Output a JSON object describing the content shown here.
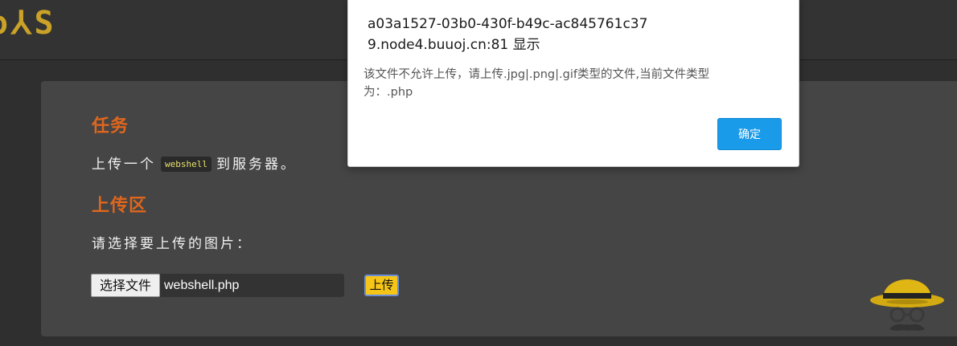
{
  "header": {
    "logo_text": "o⅄S"
  },
  "task": {
    "heading": "任务",
    "text_before": "上传一个",
    "code": "webshell",
    "text_after": "到服务器。"
  },
  "upload": {
    "heading": "上传区",
    "prompt": "请选择要上传的图片：",
    "choose_file_label": "选择文件",
    "file_name": "webshell.php",
    "submit_label": "上传"
  },
  "alert": {
    "title": "a03a1527-03b0-430f-b49c-ac845761c379.node4.buuoj.cn:81 显示",
    "message": "该文件不允许上传，请上传.jpg|.png|.gif类型的文件,当前文件类型为：.php",
    "ok_label": "确定"
  },
  "colors": {
    "background": "#2f2f2f",
    "panel": "#454545",
    "heading_orange": "#e0661c",
    "upload_button": "#f5c518",
    "dialog_button": "#1a9bea"
  }
}
